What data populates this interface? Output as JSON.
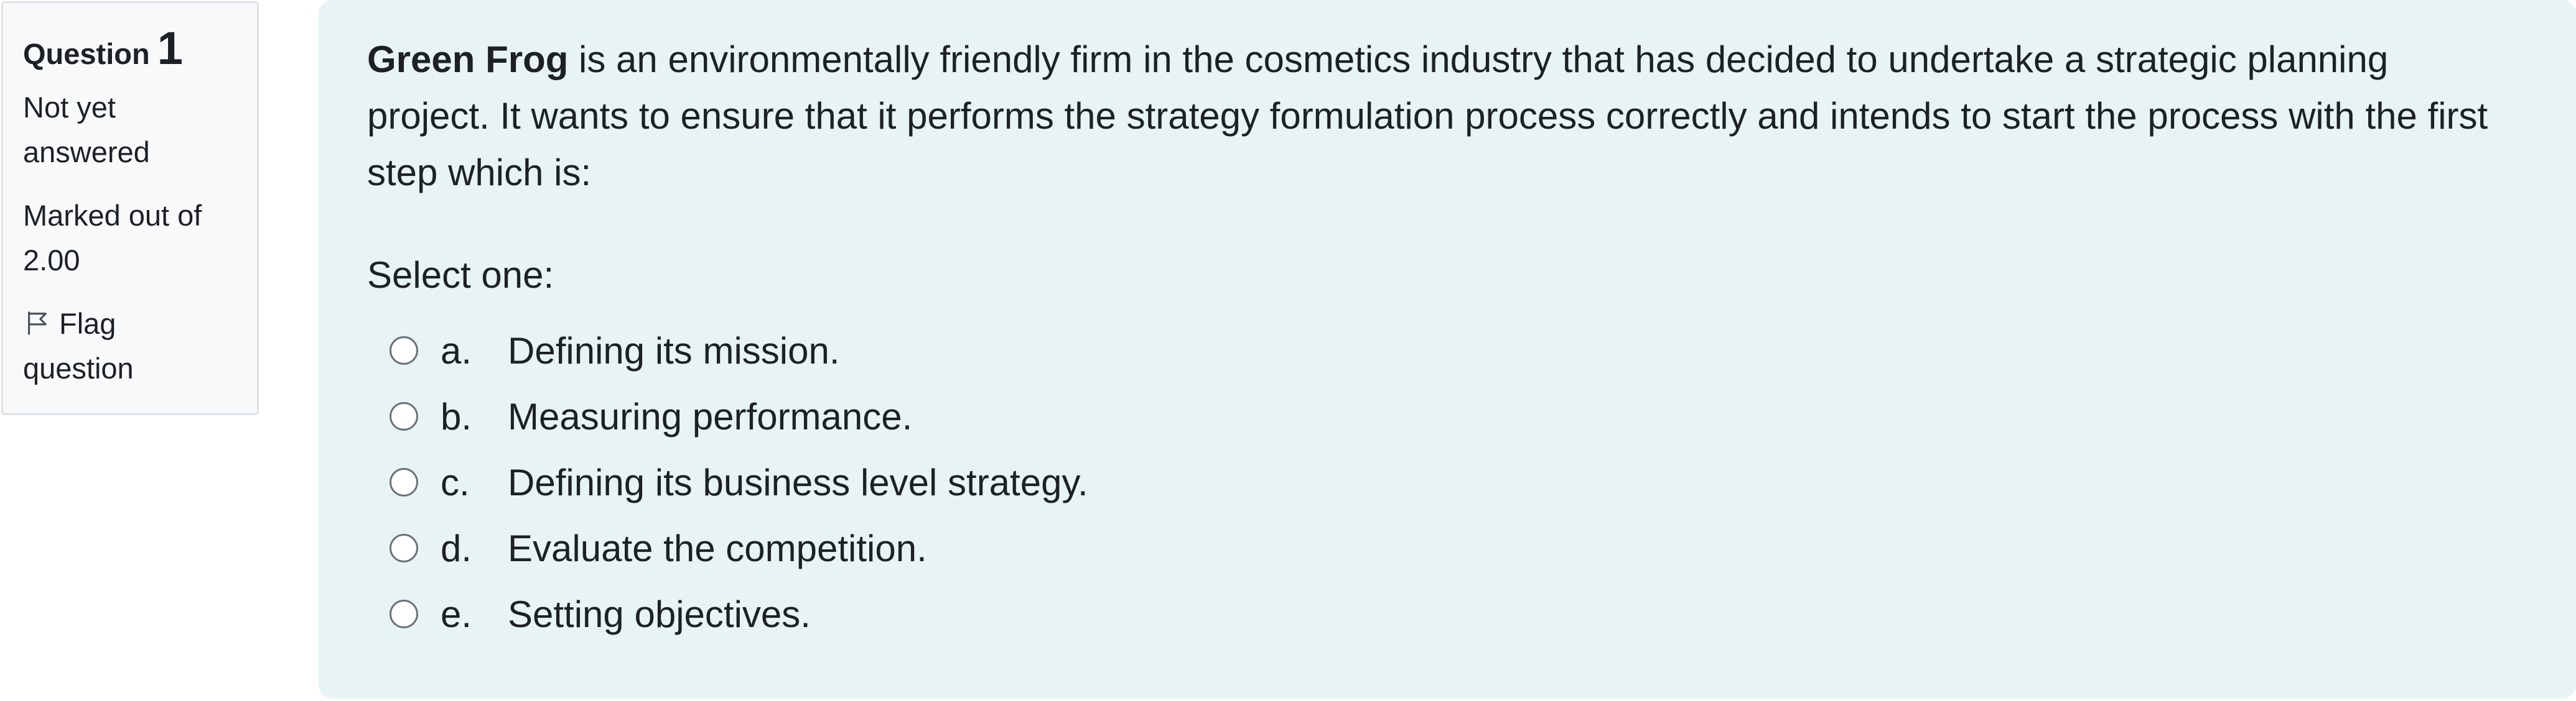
{
  "info": {
    "question_word": "Question",
    "question_number": "1",
    "state": "Not yet answered",
    "grade": "Marked out of 2.00",
    "flag_label": "Flag question",
    "flag_icon": "flag-outline-icon"
  },
  "question": {
    "bold_lead": "Green Frog",
    "text": " is an environmentally friendly firm in the cosmetics industry that has decided to undertake a strategic planning project. It wants to ensure that it performs the strategy formulation process correctly and intends to start the process with the first step which is:",
    "prompt": "Select one:",
    "answers": [
      {
        "letter": "a.",
        "text": "Defining its mission."
      },
      {
        "letter": "b.",
        "text": "Measuring performance."
      },
      {
        "letter": "c.",
        "text": "Defining its business level strategy."
      },
      {
        "letter": "d.",
        "text": "Evaluate the competition."
      },
      {
        "letter": "e.",
        "text": "Setting objectives."
      }
    ]
  },
  "colors": {
    "content_background": "#e7f3f5",
    "info_background": "#f8f9fa",
    "info_border": "#dee2e6",
    "text": "#1d2125"
  }
}
